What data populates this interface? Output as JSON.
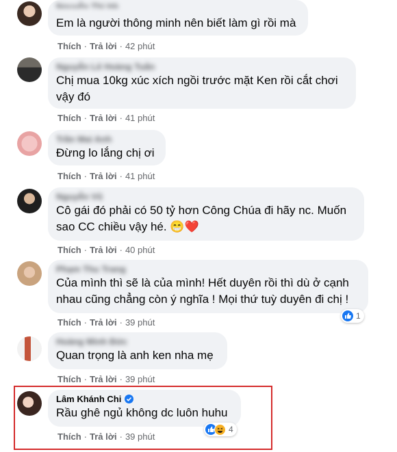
{
  "comments": [
    {
      "name": "Nguyễn Thị Hà",
      "text_lines": [
        "Em là người thông minh nên biết làm gì rồi mà"
      ],
      "like": "Thích",
      "reply": "Trả lời",
      "time": "42 phút"
    },
    {
      "name": "Nguyễn Lê Hoàng Tuấn",
      "text_lines": [
        "Chị mua 10kg xúc xích ngồi trước mặt Ken rồi cắt chơi",
        "vậy đó"
      ],
      "like": "Thích",
      "reply": "Trả lời",
      "time": "41 phút"
    },
    {
      "name": "Trần Mai Anh",
      "text_lines": [
        "Đừng lo lắng chị ơi"
      ],
      "like": "Thích",
      "reply": "Trả lời",
      "time": "41 phút"
    },
    {
      "name": "Nguyễn Vũ",
      "text_lines": [
        "Cô gái đó phải có 50 tỷ hơn Công Chúa đi hãy nc. Muốn",
        "sao CC chiều vậy hé. 😁❤️"
      ],
      "like": "Thích",
      "reply": "Trả lời",
      "time": "40 phút"
    },
    {
      "name": "Phạm Thu Trang",
      "text_lines": [
        "Của mình thì sẽ là của mình! Hết duyên rồi thì dù ở cạnh",
        "nhau cũng chẳng còn ý nghĩa ! Mọi thứ tuỳ duyên đi chị !"
      ],
      "like": "Thích",
      "reply": "Trả lời",
      "time": "39 phút",
      "reaction_count": "1"
    },
    {
      "name": "Hoàng Minh Đức",
      "text_lines": [
        "Quan trọng là anh ken nha mẹ"
      ],
      "like": "Thích",
      "reply": "Trả lời",
      "time": "39 phút"
    },
    {
      "name": "Lâm Khánh Chi",
      "text_lines": [
        "Rầu ghê ngủ không dc luôn huhu"
      ],
      "like": "Thích",
      "reply": "Trả lời",
      "time": "39 phút",
      "reaction_count": "4"
    }
  ],
  "colors": {
    "bubble": "#f0f2f5",
    "secondary_text": "#65676b",
    "highlight_border": "#d42a2a",
    "like_blue": "#1877f2"
  },
  "icons": [
    "avatar",
    "verified-badge-icon",
    "like-reaction-icon",
    "haha-reaction-icon"
  ]
}
